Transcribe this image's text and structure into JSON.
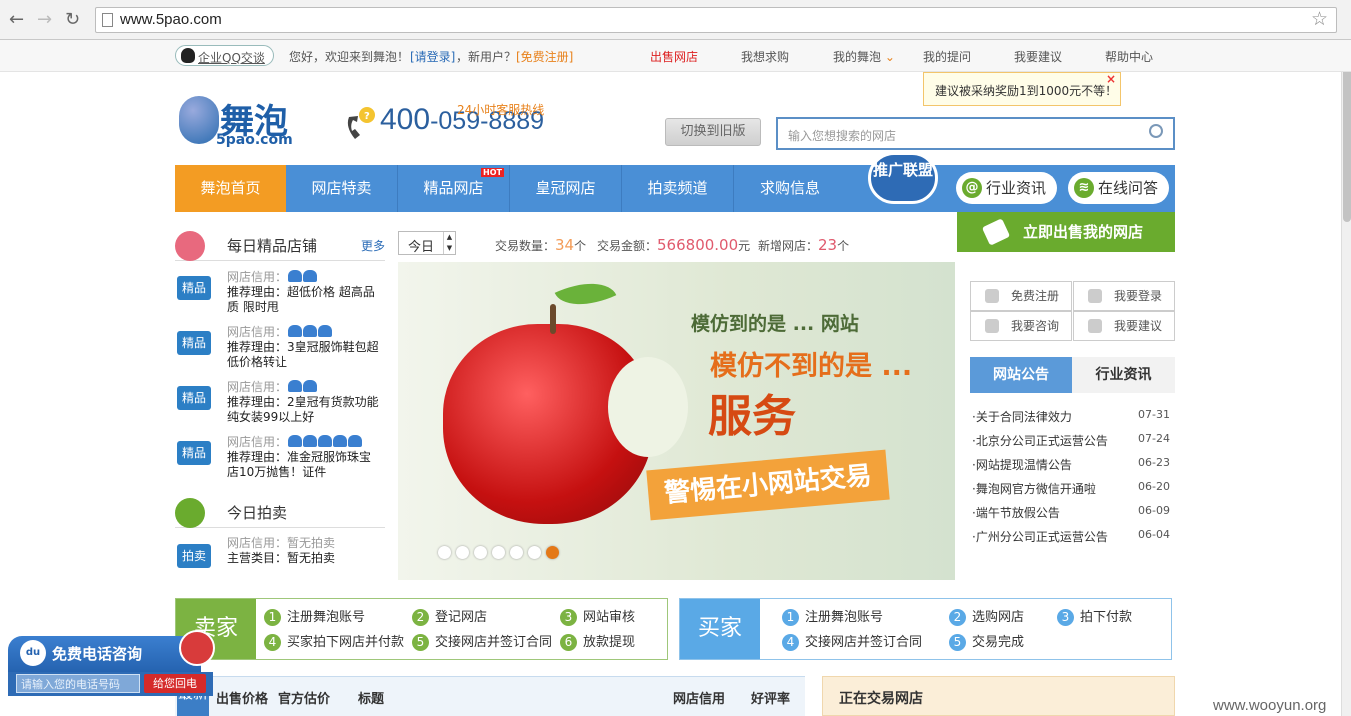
{
  "browser": {
    "url": "www.5pao.com"
  },
  "topbar": {
    "qq": "企业QQ交谈",
    "welcome": "您好，欢迎来到舞泡！",
    "login": "[请登录]",
    "newuser": "，新用户？",
    "register": "[免费注册]",
    "links": [
      "出售网店",
      "我想求购",
      "我的舞泡",
      "我的提问",
      "我要建议",
      "帮助中心"
    ],
    "tip": "建议被采纳奖励1到1000元不等！"
  },
  "header": {
    "logo_cn": "舞泡",
    "logo_en": "5pao.com",
    "hotline_label": "24小时客服热线",
    "hotline_a": "400",
    "hotline_b": "-059-8889",
    "switch_old": "切换到旧版",
    "search_placeholder": "输入您想搜索的网店"
  },
  "nav": {
    "items": [
      "舞泡首页",
      "网店特卖",
      "精品网店",
      "皇冠网店",
      "拍卖频道",
      "求购信息"
    ],
    "hot": "HOT",
    "promo": "推广联盟",
    "industry": "行业资讯",
    "qa": "在线问答",
    "sell": "立即出售我的网店"
  },
  "daily": {
    "title": "每日精品店铺",
    "more": "更多",
    "badge": "精品",
    "credit_label": "网店信用：",
    "reason_label": "推荐理由：",
    "rows": [
      {
        "gems": 2,
        "reason": "超低价格 超高品质 限时甩"
      },
      {
        "gems": 3,
        "reason": "3皇冠服饰鞋包超低价格转让"
      },
      {
        "gems": 2,
        "reason": "2皇冠有货款功能纯女装99以上好"
      },
      {
        "gems": 5,
        "reason": "准金冠服饰珠宝店10万抛售！证件"
      }
    ]
  },
  "auction": {
    "title": "今日拍卖",
    "badge": "拍卖",
    "credit": "网店信用：暂无拍卖",
    "category": "主营类目：暂无拍卖"
  },
  "stats": {
    "day": "今日",
    "count_label": "交易数量：",
    "count": "34",
    "count_unit": "个",
    "amount_label": "交易金额：",
    "amount": "566800.00",
    "amount_unit": "元",
    "new_label": "新增网店：",
    "new": "23",
    "new_unit": "个"
  },
  "banner": {
    "line1": "模仿到的是 ... 网站",
    "line2": "模仿不到的是 ...",
    "line3": "服务",
    "ribbon": "警惕在小网站交易",
    "slides": 7,
    "active_slide": 7
  },
  "rightpanel": {
    "actions": [
      "免费注册",
      "我要登录",
      "我要咨询",
      "我要建议"
    ],
    "tab_active": "网站公告",
    "tab_other": "行业资讯",
    "notices": [
      {
        "title": "关于合同法律效力",
        "date": "07-31"
      },
      {
        "title": "北京分公司正式运营公告",
        "date": "07-24"
      },
      {
        "title": "网站提现温情公告",
        "date": "06-23"
      },
      {
        "title": "舞泡网官方微信开通啦",
        "date": "06-20"
      },
      {
        "title": "端午节放假公告",
        "date": "06-09"
      },
      {
        "title": "广州分公司正式运营公告",
        "date": "06-04"
      }
    ]
  },
  "process": {
    "seller": "卖家",
    "seller_steps": [
      "注册舞泡账号",
      "登记网店",
      "网站审核",
      "买家拍下网店并付款",
      "交接网店并签订合同",
      "放款提现"
    ],
    "buyer": "买家",
    "buyer_steps": [
      "注册舞泡账号",
      "选购网店",
      "拍下付款",
      "交接网店并签订合同",
      "交易完成"
    ]
  },
  "table": {
    "latest": "最新",
    "headers": [
      "出售价格",
      "官方估价",
      "标题",
      "网店信用",
      "好评率"
    ],
    "trading": "正在交易网店"
  },
  "widget": {
    "title": "免费电话咨询",
    "logo": "du",
    "placeholder": "请输入您的电话号码",
    "button": "给您回电"
  },
  "watermark": "www.wooyun.org",
  "colors": {
    "nav_blue": "#4a8fd6",
    "home_orange": "#f39c23",
    "sell_green": "#6aab2e",
    "seller_green": "#7cb342",
    "buyer_blue": "#5aa9e6"
  }
}
